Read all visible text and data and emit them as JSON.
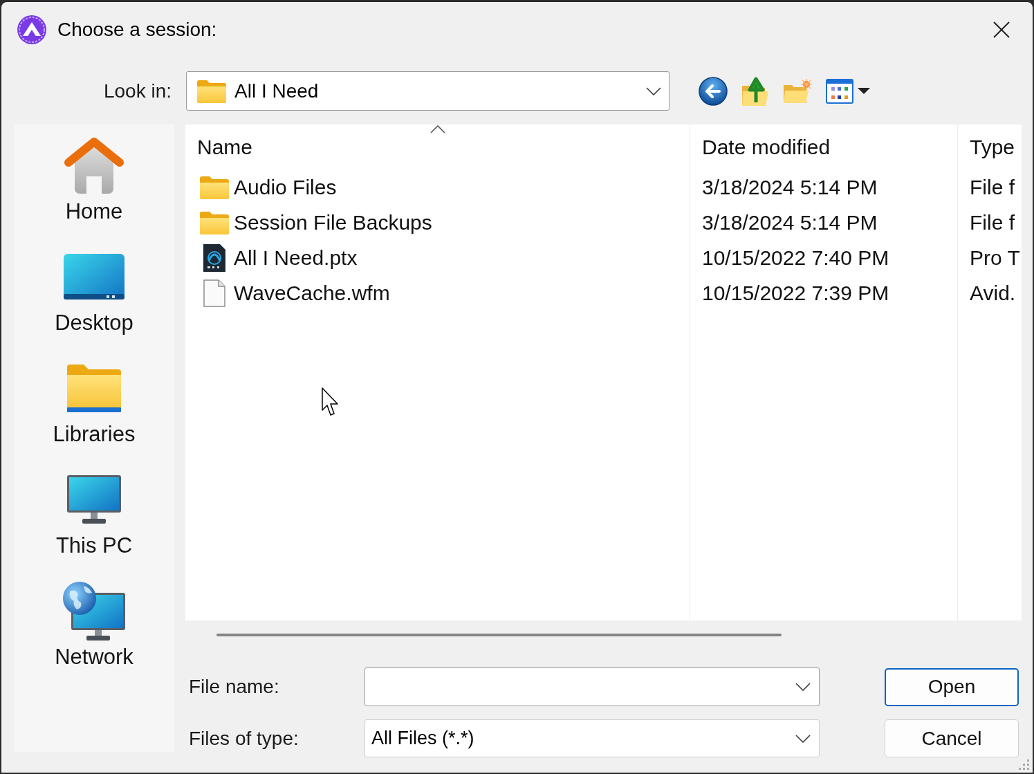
{
  "window": {
    "title": "Choose a session:"
  },
  "look_in": {
    "label": "Look in:",
    "value": "All I Need"
  },
  "places": [
    {
      "label": "Home",
      "selected": false
    },
    {
      "label": "Desktop",
      "selected": false
    },
    {
      "label": "Libraries",
      "selected": false
    },
    {
      "label": "This PC",
      "selected": false
    },
    {
      "label": "Network",
      "selected": false
    }
  ],
  "file_list": {
    "columns": [
      {
        "label": "Name",
        "sorted": true
      },
      {
        "label": "Date modified",
        "sorted": false
      },
      {
        "label": "Type",
        "sorted": false
      }
    ],
    "rows": [
      {
        "kind": "folder",
        "name": "Audio Files",
        "date_modified": "3/18/2024 5:14 PM",
        "type": "File f",
        "selected": false
      },
      {
        "kind": "folder",
        "name": "Session File Backups",
        "date_modified": "3/18/2024 5:14 PM",
        "type": "File f",
        "selected": false
      },
      {
        "kind": "session",
        "name": "All I Need.ptx",
        "date_modified": "10/15/2022 7:40 PM",
        "type": "Pro T",
        "selected": false
      },
      {
        "kind": "file",
        "name": "WaveCache.wfm",
        "date_modified": "10/15/2022 7:39 PM",
        "type": "Avid.",
        "selected": false
      }
    ]
  },
  "file_name": {
    "label": "File name:"
  },
  "file_type": {
    "label": "Files of type:",
    "value": "All Files (*.*)"
  },
  "buttons": [
    {
      "label": "Open",
      "default": true
    },
    {
      "label": "Cancel",
      "default": false
    }
  ]
}
